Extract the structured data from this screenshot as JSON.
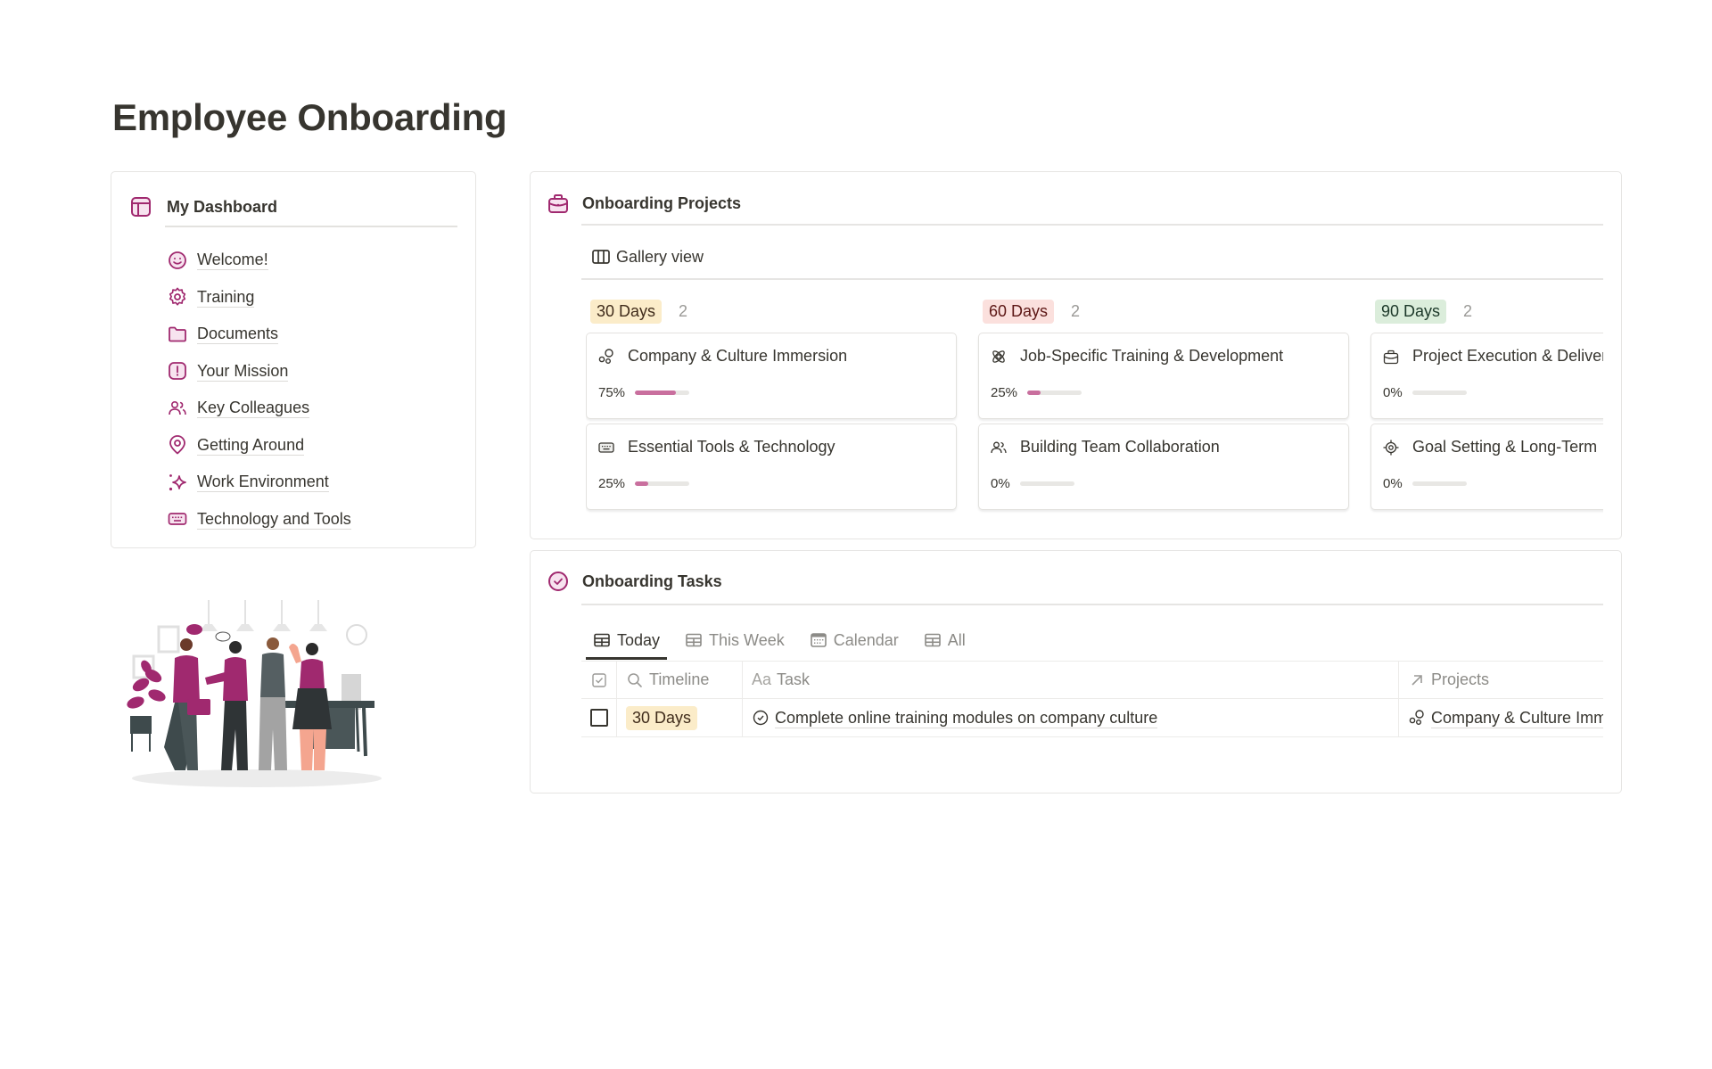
{
  "page": {
    "title": "Employee Onboarding"
  },
  "colors": {
    "accent": "#a0296f",
    "progress_fill": "#c96f9e",
    "progress_track": "#e8e7e4",
    "tag_30_bg": "#fbecc9",
    "tag_30_fg": "#402c1b",
    "tag_60_bg": "#fbe0dd",
    "tag_60_fg": "#5d1715",
    "tag_90_bg": "#dbeddb",
    "tag_90_fg": "#1c3829"
  },
  "dashboard": {
    "title": "My Dashboard",
    "icon": "layout-icon",
    "items": [
      {
        "label": "Welcome!",
        "icon": "smile-icon"
      },
      {
        "label": "Training",
        "icon": "gear-icon"
      },
      {
        "label": "Documents",
        "icon": "folder-icon"
      },
      {
        "label": "Your Mission",
        "icon": "exclamation-icon"
      },
      {
        "label": "Key Colleagues",
        "icon": "people-icon"
      },
      {
        "label": "Getting Around",
        "icon": "map-pin-icon"
      },
      {
        "label": "Work Environment",
        "icon": "sparkle-icon"
      },
      {
        "label": "Technology and Tools",
        "icon": "keyboard-icon"
      }
    ]
  },
  "projects": {
    "title": "Onboarding Projects",
    "icon": "briefcase-icon",
    "view_label": "Gallery view",
    "columns": [
      {
        "tag": "30 Days",
        "count": "2",
        "cards": [
          {
            "title": "Company & Culture Immersion",
            "icon": "bubbles-icon",
            "progress_label": "75%",
            "progress": 0.75
          },
          {
            "title": "Essential Tools & Technology",
            "icon": "keyboard-icon",
            "progress_label": "25%",
            "progress": 0.25
          }
        ]
      },
      {
        "tag": "60 Days",
        "count": "2",
        "cards": [
          {
            "title": "Job-Specific Training & Development",
            "icon": "atom-icon",
            "progress_label": "25%",
            "progress": 0.25
          },
          {
            "title": "Building Team Collaboration",
            "icon": "people-icon",
            "progress_label": "0%",
            "progress": 0
          }
        ]
      },
      {
        "tag": "90 Days",
        "count": "2",
        "cards": [
          {
            "title": "Project Execution & Delivery",
            "icon": "briefcase-icon",
            "progress_label": "0%",
            "progress": 0
          },
          {
            "title": "Goal Setting & Long-Term",
            "icon": "target-icon",
            "progress_label": "0%",
            "progress": 0
          }
        ]
      }
    ]
  },
  "tasks": {
    "title": "Onboarding Tasks",
    "icon": "check-circle-icon",
    "tabs": [
      {
        "label": "Today",
        "active": true
      },
      {
        "label": "This Week",
        "active": false
      },
      {
        "label": "Calendar",
        "active": false
      },
      {
        "label": "All",
        "active": false
      }
    ],
    "columns": {
      "timeline": "Timeline",
      "task": "Task",
      "task_prefix": "Aa",
      "projects": "Projects"
    },
    "rows": [
      {
        "done": false,
        "timeline": "30 Days",
        "task": "Complete online training modules on company culture",
        "project": "Company & Culture Immersion"
      }
    ]
  }
}
